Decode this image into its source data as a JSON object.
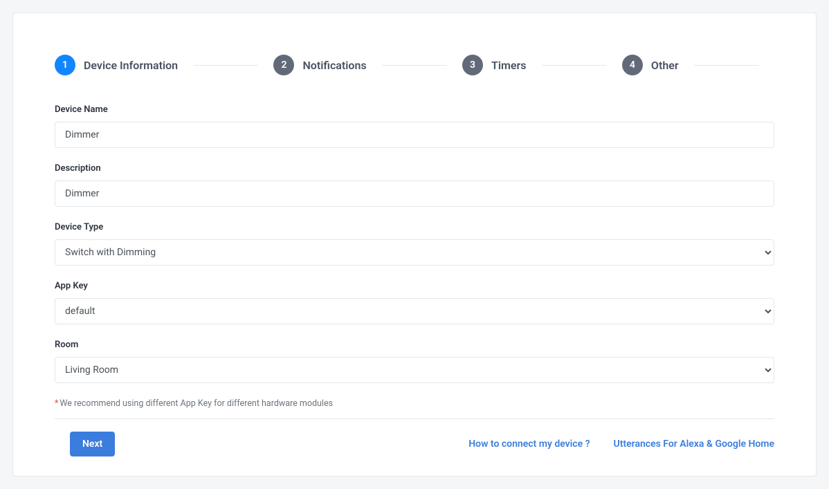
{
  "stepper": [
    {
      "num": "1",
      "label": "Device Information",
      "active": true
    },
    {
      "num": "2",
      "label": "Notifications",
      "active": false
    },
    {
      "num": "3",
      "label": "Timers",
      "active": false
    },
    {
      "num": "4",
      "label": "Other",
      "active": false
    }
  ],
  "form": {
    "deviceName": {
      "label": "Device Name",
      "value": "Dimmer"
    },
    "description": {
      "label": "Description",
      "value": "Dimmer"
    },
    "deviceType": {
      "label": "Device Type",
      "value": "Switch with Dimming"
    },
    "appKey": {
      "label": "App Key",
      "value": "default"
    },
    "room": {
      "label": "Room",
      "value": "Living Room"
    }
  },
  "hint": "We recommend using different App Key for different hardware modules",
  "buttons": {
    "next": "Next"
  },
  "links": {
    "howTo": "How to connect my device ?",
    "utterances": "Utterances For Alexa & Google Home"
  }
}
